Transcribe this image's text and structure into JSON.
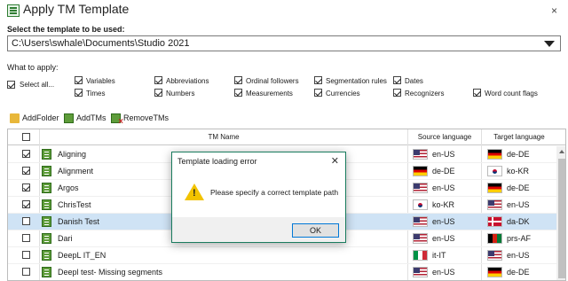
{
  "window": {
    "title": "Apply TM Template",
    "close_glyph": "×"
  },
  "template": {
    "label": "Select the template to be used:",
    "path": "C:\\Users\\swhale\\Documents\\Studio 2021"
  },
  "apply": {
    "label": "What to apply:",
    "select_all": {
      "label": "Select all...",
      "checked": true
    },
    "options": [
      {
        "label": "Variables",
        "checked": true
      },
      {
        "label": "Times",
        "checked": true
      },
      {
        "label": "Abbreviations",
        "checked": true
      },
      {
        "label": "Numbers",
        "checked": true
      },
      {
        "label": "Ordinal followers",
        "checked": true
      },
      {
        "label": "Measurements",
        "checked": true
      },
      {
        "label": "Segmentation rules",
        "checked": true
      },
      {
        "label": "Currencies",
        "checked": true
      },
      {
        "label": "Dates",
        "checked": true
      },
      {
        "label": "Recognizers",
        "checked": true
      },
      {
        "label": "Word count flags",
        "checked": true
      }
    ]
  },
  "toolbar": {
    "add_folder": "AddFolder",
    "add_tms": "AddTMs",
    "remove_tms": "RemoveTMs"
  },
  "grid": {
    "headers": {
      "tm_name": "TM Name",
      "source": "Source language",
      "target": "Target language"
    },
    "rows": [
      {
        "checked": true,
        "name": "Aligning",
        "source": "en-US",
        "source_flag": "us",
        "target": "de-DE",
        "target_flag": "de",
        "selected": false
      },
      {
        "checked": true,
        "name": "Alignment",
        "source": "de-DE",
        "source_flag": "de",
        "target": "ko-KR",
        "target_flag": "kr",
        "selected": false
      },
      {
        "checked": true,
        "name": "Argos",
        "source": "en-US",
        "source_flag": "us",
        "target": "de-DE",
        "target_flag": "de",
        "selected": false
      },
      {
        "checked": true,
        "name": "ChrisTest",
        "source": "ko-KR",
        "source_flag": "kr",
        "target": "en-US",
        "target_flag": "us",
        "selected": false
      },
      {
        "checked": false,
        "name": "Danish Test",
        "source": "en-US",
        "source_flag": "us",
        "target": "da-DK",
        "target_flag": "dk",
        "selected": true
      },
      {
        "checked": false,
        "name": "Dari",
        "source": "en-US",
        "source_flag": "us",
        "target": "prs-AF",
        "target_flag": "af",
        "selected": false
      },
      {
        "checked": false,
        "name": "DeepL IT_EN",
        "source": "it-IT",
        "source_flag": "it",
        "target": "en-US",
        "target_flag": "us",
        "selected": false
      },
      {
        "checked": false,
        "name": "Deepl test- Missing segments",
        "source": "en-US",
        "source_flag": "us",
        "target": "de-DE",
        "target_flag": "de",
        "selected": false
      }
    ]
  },
  "dialog": {
    "title": "Template loading error",
    "close_glyph": "✕",
    "message": "Please specify a correct template path",
    "ok": "OK",
    "icon": "warning-icon"
  }
}
